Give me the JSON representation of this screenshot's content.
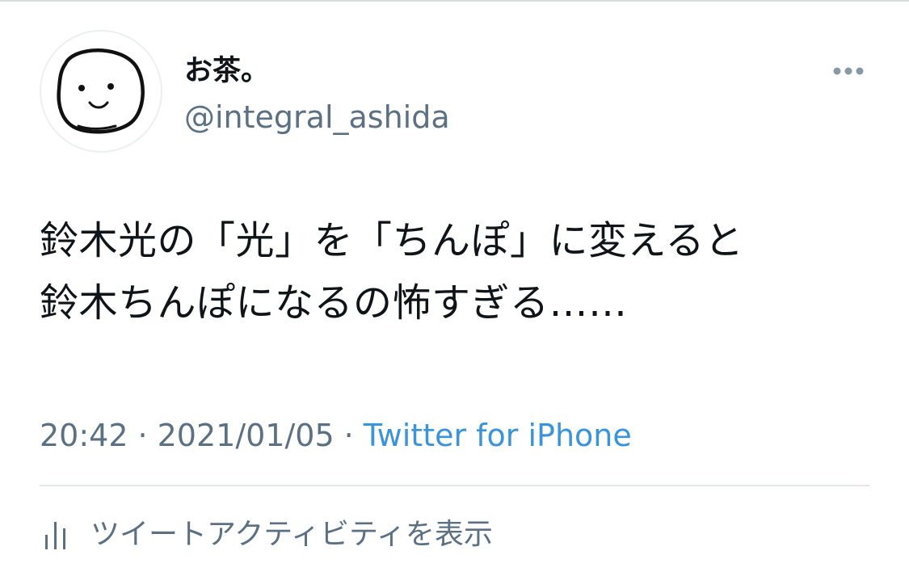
{
  "user": {
    "display_name": "お茶。",
    "handle": "@integral_ashida"
  },
  "tweet": {
    "lines": [
      "鈴木光の「光」を「ちんぽ」に変えると",
      "鈴木ちんぽになるの怖すぎる……"
    ],
    "time": "20:42",
    "date": "2021/01/05",
    "separator": "·",
    "source": "Twitter for iPhone"
  },
  "actions": {
    "activity_label": "ツイートアクティビティを表示"
  },
  "icons": {
    "avatar": "hand-drawn-smiley-avatar",
    "more": "more-dots-icon",
    "activity": "bar-chart-icon"
  },
  "colors": {
    "text": "#0f1419",
    "secondary": "#5b7083",
    "link": "#3b94d9",
    "divider": "#e3e6e9"
  }
}
